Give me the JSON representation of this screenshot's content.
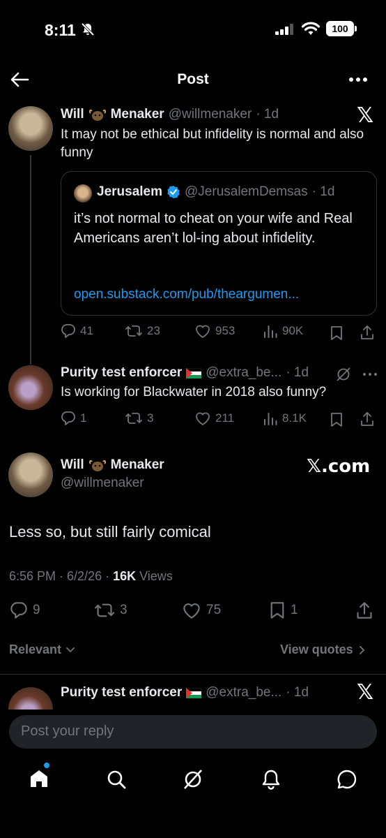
{
  "status_bar": {
    "time": "8:11",
    "battery": "100"
  },
  "header": {
    "title": "Post"
  },
  "tweet1": {
    "name_first": "Will",
    "name_last": "Menaker",
    "handle": "@willmenaker",
    "time": "· 1d",
    "x_logo": "𝕏",
    "text": "It may not be ethical but infidelity is normal and also funny",
    "actions": {
      "replies": "41",
      "reposts": "23",
      "likes": "953",
      "views": "90K"
    }
  },
  "quote": {
    "name": "Jerusalem",
    "handle": "@JerusalemDemsas",
    "time": "· 1d",
    "text": "it’s not normal to cheat on your wife and Real Americans aren’t lol-ing about infidelity.",
    "link": "open.substack.com/pub/theargumen..."
  },
  "tweet2": {
    "name": "Purity test enforcer",
    "handle": "@extra_be...",
    "time": "· 1d",
    "text": "Is working for Blackwater in 2018 also funny?",
    "actions": {
      "replies": "1",
      "reposts": "3",
      "likes": "211",
      "views": "8.1K"
    }
  },
  "main": {
    "name_first": "Will",
    "name_last": "Menaker",
    "handle": "@willmenaker",
    "source": "𝕏.com",
    "text": "Less so, but still fairly comical",
    "timestamp": "6:56 PM · 6/2/26 · ",
    "views_count": "16K",
    "views_label": " Views",
    "actions": {
      "replies": "9",
      "reposts": "3",
      "likes": "75",
      "bookmarks": "1"
    }
  },
  "sort": {
    "label": "Relevant",
    "view_quotes": "View quotes"
  },
  "reply_preview": {
    "name": "Purity test enforcer",
    "handle": "@extra_be...",
    "time": "· 1d",
    "x_logo": "𝕏"
  },
  "reply_box": {
    "placeholder": "Post your reply"
  },
  "colors": {
    "accent": "#1d9bf0",
    "muted": "#71767b",
    "text": "#e7e9ea",
    "background": "#000000"
  },
  "icons": [
    "back-arrow-icon",
    "more-icon",
    "verified-icon",
    "reply-icon",
    "repost-icon",
    "like-icon",
    "views-icon",
    "bookmark-icon",
    "share-icon",
    "grok-icon",
    "home-icon",
    "search-icon",
    "notifications-icon",
    "messages-icon"
  ]
}
